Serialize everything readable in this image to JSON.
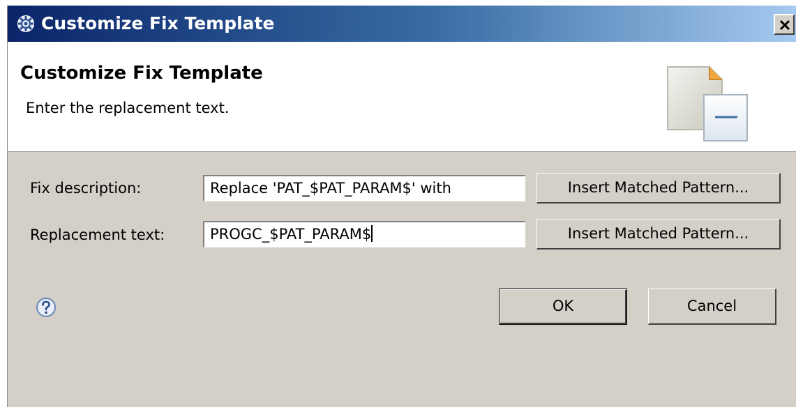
{
  "window": {
    "title": "Customize Fix Template"
  },
  "header": {
    "title": "Customize Fix Template",
    "description": "Enter the replacement text."
  },
  "form": {
    "fix_description": {
      "label": "Fix description:",
      "value": "Replace 'PAT_$PAT_PARAM$' with",
      "insert_button": "Insert Matched Pattern..."
    },
    "replacement_text": {
      "label": "Replacement text:",
      "value": "PROGC_$PAT_PARAM$",
      "insert_button": "Insert Matched Pattern..."
    }
  },
  "buttons": {
    "ok": "OK",
    "cancel": "Cancel"
  },
  "icons": {
    "title": "gear-icon",
    "close": "close-icon",
    "banner": "document-template-icon",
    "help": "help-icon"
  },
  "colors": {
    "title_bar_start": "#0a246a",
    "title_bar_end": "#a6caf0",
    "dialog_background": "#d4d0c8"
  }
}
